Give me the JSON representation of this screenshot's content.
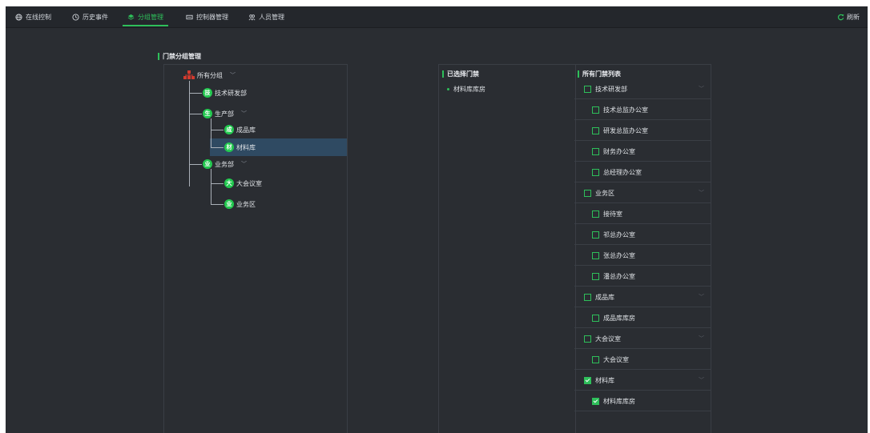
{
  "nav": {
    "items": [
      {
        "label": "在线控制",
        "icon": "globe-icon"
      },
      {
        "label": "历史事件",
        "icon": "clock-icon"
      },
      {
        "label": "分组管理",
        "icon": "layers-icon",
        "active": true
      },
      {
        "label": "控制器管理",
        "icon": "controller-icon"
      },
      {
        "label": "人员管理",
        "icon": "people-icon"
      }
    ],
    "refresh_label": "刷新"
  },
  "colors": {
    "accent": "#2ebf5a",
    "background": "#2a2d32",
    "highlight": "#2f4a62"
  },
  "tree": {
    "title": "门禁分组管理",
    "root": {
      "label": "所有分组",
      "icon": "group-icon"
    },
    "nodes": [
      {
        "badge": "技",
        "label": "技术研发部"
      },
      {
        "badge": "生",
        "label": "生产部"
      },
      {
        "badge": "成",
        "label": "成品库"
      },
      {
        "badge": "材",
        "label": "材料库"
      },
      {
        "badge": "业",
        "label": "业务部"
      },
      {
        "badge": "大",
        "label": "大会议室"
      },
      {
        "badge": "业",
        "label": "业务区"
      }
    ]
  },
  "selected": {
    "title": "已选择门禁",
    "items": [
      "材料库库房"
    ]
  },
  "all_doors": {
    "title": "所有门禁列表",
    "rows": [
      {
        "label": "技术研发部",
        "group": true,
        "checked": false
      },
      {
        "label": "技术总监办公室",
        "group": false,
        "checked": false
      },
      {
        "label": "研发总监办公室",
        "group": false,
        "checked": false
      },
      {
        "label": "财务办公室",
        "group": false,
        "checked": false
      },
      {
        "label": "总经理办公室",
        "group": false,
        "checked": false
      },
      {
        "label": "业务区",
        "group": true,
        "checked": false
      },
      {
        "label": "接待室",
        "group": false,
        "checked": false
      },
      {
        "label": "祁总办公室",
        "group": false,
        "checked": false
      },
      {
        "label": "张总办公室",
        "group": false,
        "checked": false
      },
      {
        "label": "潘总办公室",
        "group": false,
        "checked": false
      },
      {
        "label": "成品库",
        "group": true,
        "checked": false
      },
      {
        "label": "成品库库房",
        "group": false,
        "checked": false
      },
      {
        "label": "大会议室",
        "group": true,
        "checked": false
      },
      {
        "label": "大会议室",
        "group": false,
        "checked": false
      },
      {
        "label": "材料库",
        "group": true,
        "checked": true
      },
      {
        "label": "材料库库房",
        "group": false,
        "checked": true
      }
    ]
  }
}
